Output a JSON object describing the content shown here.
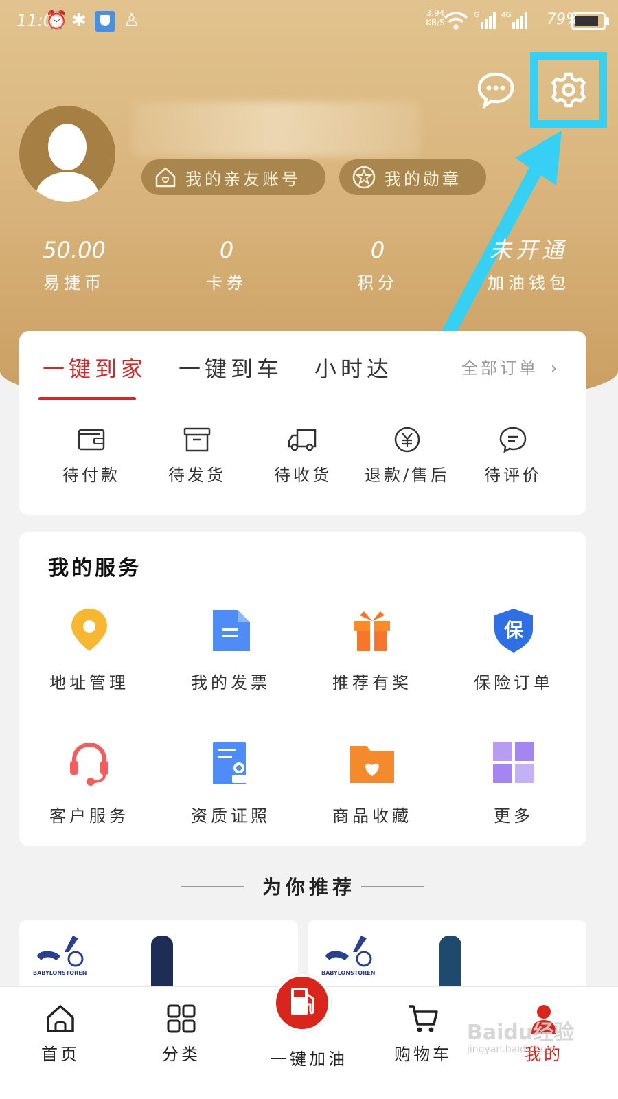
{
  "status_bar": {
    "time": "11:09",
    "net_speed": "3.94",
    "net_unit": "KB/S",
    "network_g": "G",
    "network_4g": "4G",
    "battery_pct": "79%"
  },
  "stats": [
    {
      "value": "50.00",
      "label": "易捷币"
    },
    {
      "value": "0",
      "label": "卡券"
    },
    {
      "value": "0",
      "label": "积分"
    },
    {
      "value": "未开通",
      "label": "加油钱包"
    }
  ],
  "pills": {
    "friends": "我的亲友账号",
    "medals": "我的勋章"
  },
  "order_tabs": [
    {
      "label": "一键到家"
    },
    {
      "label": "一键到车"
    },
    {
      "label": "小时达"
    }
  ],
  "all_orders": "全部订单",
  "order_items": [
    {
      "label": "待付款",
      "icon": "wallet-icon"
    },
    {
      "label": "待发货",
      "icon": "box-icon"
    },
    {
      "label": "待收货",
      "icon": "truck-icon"
    },
    {
      "label": "退款/售后",
      "icon": "yuan-icon"
    },
    {
      "label": "待评价",
      "icon": "comment-icon"
    }
  ],
  "services": {
    "title": "我的服务",
    "items": [
      {
        "label": "地址管理",
        "icon": "location-icon"
      },
      {
        "label": "我的发票",
        "icon": "invoice-icon"
      },
      {
        "label": "推荐有奖",
        "icon": "gift-icon"
      },
      {
        "label": "保险订单",
        "icon": "insurance-icon"
      },
      {
        "label": "客户服务",
        "icon": "headset-icon"
      },
      {
        "label": "资质证照",
        "icon": "certificate-icon"
      },
      {
        "label": "商品收藏",
        "icon": "favorite-folder-icon"
      },
      {
        "label": "更多",
        "icon": "grid-more-icon"
      }
    ]
  },
  "insurance_badge": "保",
  "recommend_title": "为你推荐",
  "brand_name": "BABYLONSTOREN",
  "bottom_nav": [
    {
      "label": "首页",
      "icon": "home-icon"
    },
    {
      "label": "分类",
      "icon": "category-icon"
    },
    {
      "label": "一键加油",
      "icon": "fuel-pump-icon"
    },
    {
      "label": "购物车",
      "icon": "cart-icon"
    },
    {
      "label": "我的",
      "icon": "profile-icon"
    }
  ],
  "watermark": {
    "main": "Baidu经验",
    "sub": "jingyan.baidu.com"
  },
  "colors": {
    "accent_red": "#cf2a2a",
    "header_gold": "#d9b57d",
    "highlight_cyan": "#36d0f5"
  }
}
